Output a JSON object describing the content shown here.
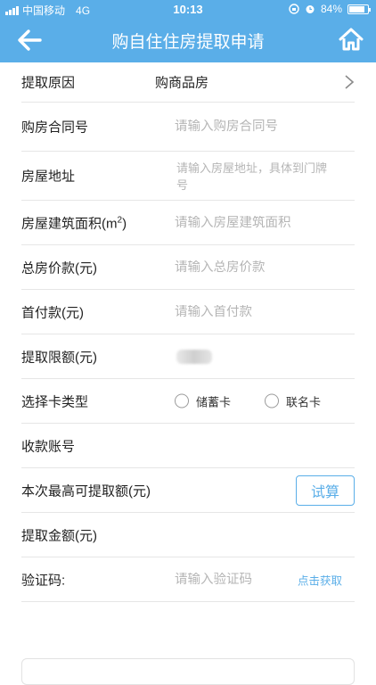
{
  "status_bar": {
    "carrier": "中国移动",
    "network": "4G",
    "time": "10:13",
    "battery_text": "84%",
    "battery_level": 0.84
  },
  "nav": {
    "title": "购自住住房提取申请",
    "back_icon": "arrow-left-icon",
    "home_icon": "home-icon"
  },
  "form": {
    "reason": {
      "label": "提取原因",
      "value": "购商品房"
    },
    "contract_no": {
      "label": "购房合同号",
      "placeholder": "请输入购房合同号"
    },
    "address": {
      "label": "房屋地址",
      "placeholder": "请输入房屋地址，具体到门牌号"
    },
    "area": {
      "label_main": "房屋建筑面积(m",
      "label_sup": "2",
      "label_tail": ")",
      "placeholder": "请输入房屋建筑面积"
    },
    "total_price": {
      "label": "总房价款(元)",
      "placeholder": "请输入总房价款"
    },
    "down_payment": {
      "label": "首付款(元)",
      "placeholder": "请输入首付款"
    },
    "limit": {
      "label": "提取限额(元)"
    },
    "card_type": {
      "label": "选择卡类型",
      "options": [
        "储蓄卡",
        "联名卡"
      ]
    },
    "account": {
      "label": "收款账号"
    },
    "max_amount": {
      "label": "本次最高可提取额(元)",
      "button": "试算"
    },
    "amount": {
      "label": "提取金额(元)"
    },
    "verify": {
      "label": "验证码:",
      "placeholder": "请输入验证码",
      "get_code": "点击获取"
    }
  },
  "colors": {
    "primary": "#5aaee8",
    "divider": "#e6e6e6",
    "placeholder": "#b5b5b5"
  }
}
